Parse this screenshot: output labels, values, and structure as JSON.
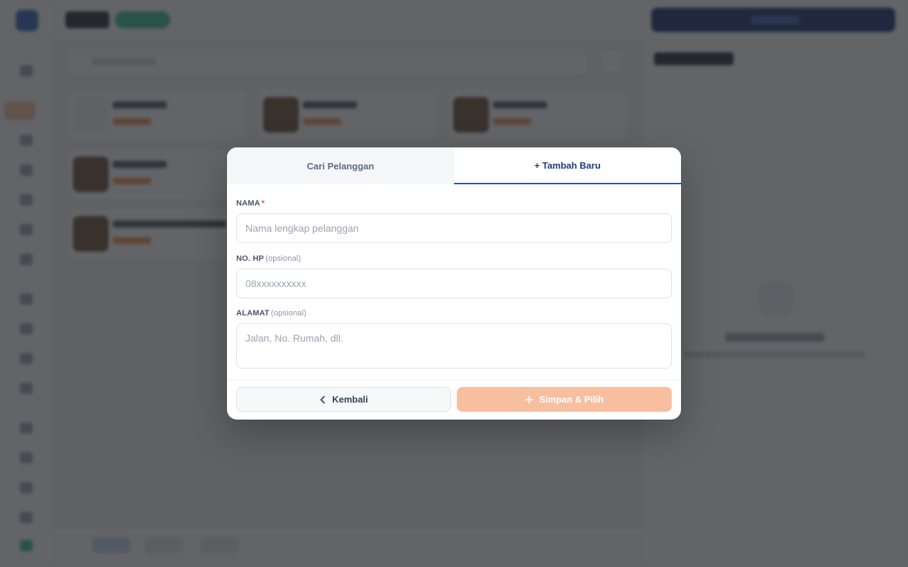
{
  "modal": {
    "tabs": [
      {
        "label": "Cari Pelanggan",
        "active": false
      },
      {
        "label": "+ Tambah Baru",
        "active": true
      }
    ],
    "fields": {
      "nama": {
        "label": "NAMA",
        "required_mark": "*",
        "placeholder": "Nama lengkap pelanggan",
        "value": ""
      },
      "hp": {
        "label": "NO. HP",
        "hint": "(opsional)",
        "placeholder": "08xxxxxxxxxx",
        "value": ""
      },
      "alamat": {
        "label": "ALAMAT",
        "hint": "(opsional)",
        "placeholder": "Jalan, No. Rumah, dll.",
        "value": ""
      }
    },
    "buttons": {
      "back": {
        "label": "Kembali",
        "icon": "chevron-left-icon"
      },
      "save": {
        "label": "Simpan & Pilih",
        "icon": "plus-icon",
        "disabled": true
      }
    }
  },
  "colors": {
    "accent": "#2c4f9e",
    "save_button": "#f7bfa0",
    "overlay": "#26282d",
    "required": "#e5484d"
  }
}
